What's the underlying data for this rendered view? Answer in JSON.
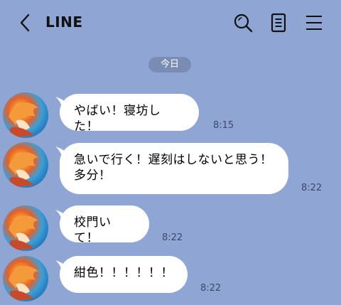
{
  "header": {
    "title": "LINE"
  },
  "date_badge": "今日",
  "messages": [
    {
      "text": "やばい！寝坊した！",
      "time": "8:15"
    },
    {
      "text": "急いで行く！遅刻はしないと思う！\n多分！",
      "time": "8:22"
    },
    {
      "text": "校門いて！",
      "time": "8:22"
    },
    {
      "text": "紺色！！！！！！",
      "time": "8:22"
    }
  ],
  "icons": {
    "back": "chevron-left-icon",
    "search": "search-icon",
    "notes": "note-icon",
    "menu": "hamburger-menu-icon",
    "avatar": "profile-avatar"
  },
  "colors": {
    "background": "#8fa5d3",
    "bubble": "#ffffff",
    "date_badge": "#7a8cb3"
  }
}
